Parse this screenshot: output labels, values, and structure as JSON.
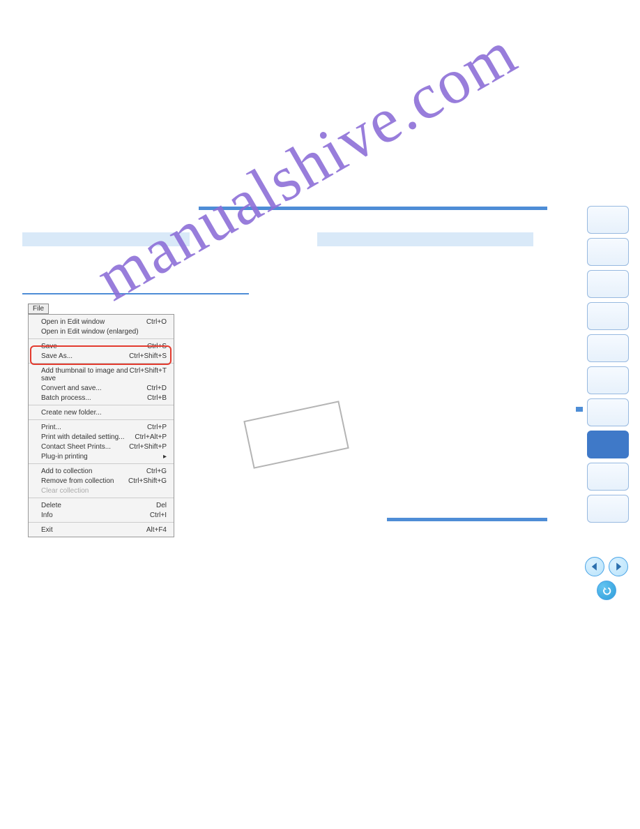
{
  "watermark": "manualshive.com",
  "menu": {
    "tab": "File",
    "items": {
      "open_edit": {
        "label": "Open in Edit window",
        "shortcut": "Ctrl+O"
      },
      "open_enlarged": {
        "label": "Open in Edit window (enlarged)",
        "shortcut": ""
      },
      "save": {
        "label": "Save",
        "shortcut": "Ctrl+S"
      },
      "save_as": {
        "label": "Save As...",
        "shortcut": "Ctrl+Shift+S"
      },
      "add_thumb": {
        "label": "Add thumbnail to image and save",
        "shortcut": "Ctrl+Shift+T"
      },
      "convert_save": {
        "label": "Convert and save...",
        "shortcut": "Ctrl+D"
      },
      "batch": {
        "label": "Batch process...",
        "shortcut": "Ctrl+B"
      },
      "create_folder": {
        "label": "Create new folder...",
        "shortcut": ""
      },
      "print": {
        "label": "Print...",
        "shortcut": "Ctrl+P"
      },
      "print_detailed": {
        "label": "Print with detailed setting...",
        "shortcut": "Ctrl+Alt+P"
      },
      "contact_sheet": {
        "label": "Contact Sheet Prints...",
        "shortcut": "Ctrl+Shift+P"
      },
      "plugin_printing": {
        "label": "Plug-in printing",
        "shortcut": "▸"
      },
      "add_collection": {
        "label": "Add to collection",
        "shortcut": "Ctrl+G"
      },
      "remove_collection": {
        "label": "Remove from collection",
        "shortcut": "Ctrl+Shift+G"
      },
      "clear_collection": {
        "label": "Clear collection",
        "shortcut": ""
      },
      "delete": {
        "label": "Delete",
        "shortcut": "Del"
      },
      "info": {
        "label": "Info",
        "shortcut": "Ctrl+I"
      },
      "exit": {
        "label": "Exit",
        "shortcut": "Alt+F4"
      }
    }
  }
}
